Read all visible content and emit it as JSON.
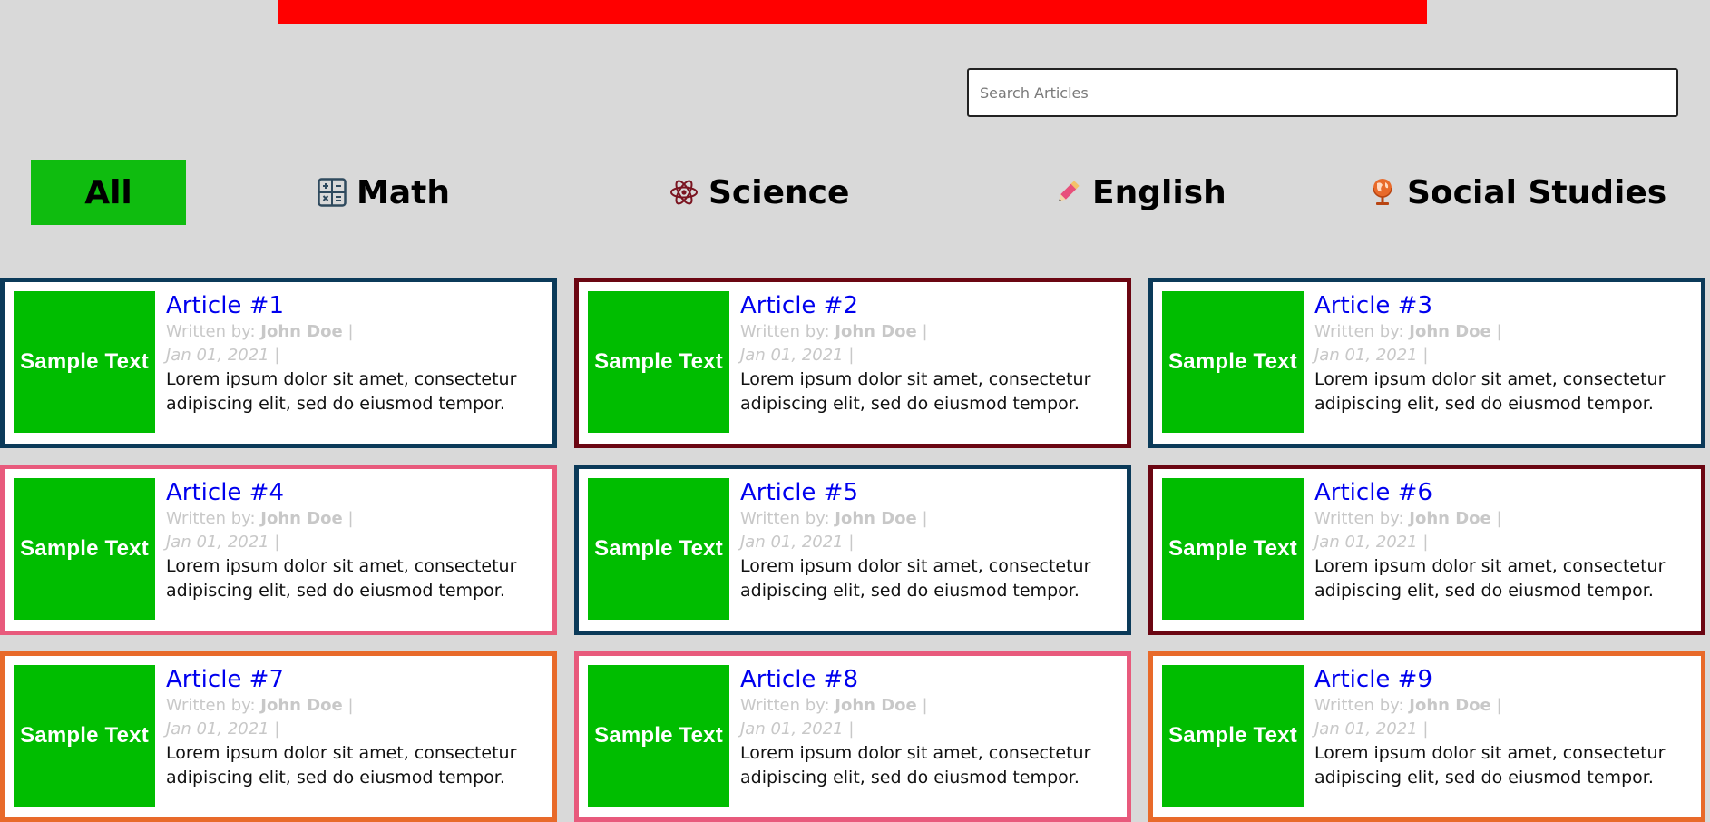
{
  "search": {
    "placeholder": "Search Articles"
  },
  "filters": [
    {
      "label": "All",
      "icon": "",
      "active": true
    },
    {
      "label": "Math",
      "icon": "calculator-icon",
      "active": false
    },
    {
      "label": "Science",
      "icon": "atom-icon",
      "active": false
    },
    {
      "label": "English",
      "icon": "pencil-icon",
      "active": false
    },
    {
      "label": "Social Studies",
      "icon": "globe-icon",
      "active": false
    }
  ],
  "colors": {
    "topbar": "#ff0000",
    "active_filter": "#0fbc0f",
    "thumbnail": "#00bd00",
    "math_border": "#0b3a59",
    "science_border": "#6b0612",
    "english_border": "#e85a7c",
    "social_border": "#e86a2a"
  },
  "articles": [
    {
      "title": "Article #1",
      "thumb": "Sample Text",
      "written_by": "Written by: ",
      "author": "John Doe",
      "sep": " |",
      "date": "Jan 01, 2021",
      "excerpt": "Lorem ipsum dolor sit amet, consectetur adipiscing elit, sed do eiusmod tempor.",
      "subject": "math"
    },
    {
      "title": "Article #2",
      "thumb": "Sample Text",
      "written_by": "Written by: ",
      "author": "John Doe",
      "sep": " |",
      "date": "Jan 01, 2021",
      "excerpt": "Lorem ipsum dolor sit amet, consectetur adipiscing elit, sed do eiusmod tempor.",
      "subject": "science"
    },
    {
      "title": "Article #3",
      "thumb": "Sample Text",
      "written_by": "Written by: ",
      "author": "John Doe",
      "sep": " |",
      "date": "Jan 01, 2021",
      "excerpt": "Lorem ipsum dolor sit amet, consectetur adipiscing elit, sed do eiusmod tempor.",
      "subject": "math"
    },
    {
      "title": "Article #4",
      "thumb": "Sample Text",
      "written_by": "Written by: ",
      "author": "John Doe",
      "sep": " |",
      "date": "Jan 01, 2021",
      "excerpt": "Lorem ipsum dolor sit amet, consectetur adipiscing elit, sed do eiusmod tempor.",
      "subject": "english"
    },
    {
      "title": "Article #5",
      "thumb": "Sample Text",
      "written_by": "Written by: ",
      "author": "John Doe",
      "sep": " |",
      "date": "Jan 01, 2021",
      "excerpt": "Lorem ipsum dolor sit amet, consectetur adipiscing elit, sed do eiusmod tempor.",
      "subject": "math"
    },
    {
      "title": "Article #6",
      "thumb": "Sample Text",
      "written_by": "Written by: ",
      "author": "John Doe",
      "sep": " |",
      "date": "Jan 01, 2021",
      "excerpt": "Lorem ipsum dolor sit amet, consectetur adipiscing elit, sed do eiusmod tempor.",
      "subject": "science"
    },
    {
      "title": "Article #7",
      "thumb": "Sample Text",
      "written_by": "Written by: ",
      "author": "John Doe",
      "sep": " |",
      "date": "Jan 01, 2021",
      "excerpt": "Lorem ipsum dolor sit amet, consectetur adipiscing elit, sed do eiusmod tempor.",
      "subject": "social"
    },
    {
      "title": "Article #8",
      "thumb": "Sample Text",
      "written_by": "Written by: ",
      "author": "John Doe",
      "sep": " |",
      "date": "Jan 01, 2021",
      "excerpt": "Lorem ipsum dolor sit amet, consectetur adipiscing elit, sed do eiusmod tempor.",
      "subject": "english"
    },
    {
      "title": "Article #9",
      "thumb": "Sample Text",
      "written_by": "Written by: ",
      "author": "John Doe",
      "sep": " |",
      "date": "Jan 01, 2021",
      "excerpt": "Lorem ipsum dolor sit amet, consectetur adipiscing elit, sed do eiusmod tempor.",
      "subject": "social"
    }
  ]
}
